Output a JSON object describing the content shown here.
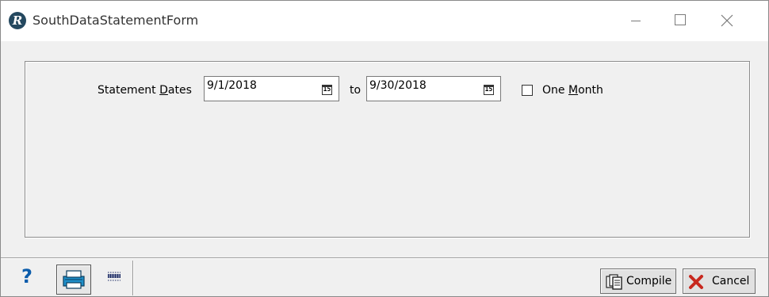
{
  "window": {
    "title": "SouthDataStatementForm",
    "app_icon_letter": "R"
  },
  "form": {
    "statement_dates_label_pre": "Statement ",
    "statement_dates_label_u": "D",
    "statement_dates_label_post": "ates",
    "date_from": "9/1/2018",
    "to_label": "to",
    "date_to": "9/30/2018",
    "calendar_icon_text": "15",
    "one_month_label_pre": "One ",
    "one_month_label_u": "M",
    "one_month_label_post": "onth",
    "one_month_checked": false
  },
  "toolbar": {
    "help_glyph": "?",
    "icons": [
      "help-icon",
      "printer-icon",
      "grid-icon"
    ]
  },
  "buttons": {
    "compile_label": "Compile",
    "cancel_label": "Cancel"
  },
  "colors": {
    "help_blue": "#0b5cab",
    "cancel_red": "#c8281e",
    "app_icon": "#24485f"
  }
}
